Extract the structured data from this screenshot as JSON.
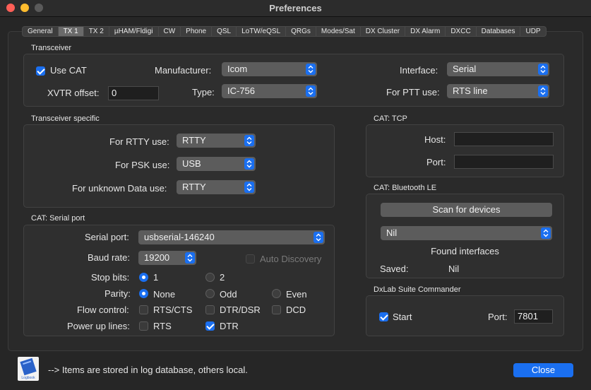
{
  "window": {
    "title": "Preferences"
  },
  "tabs": [
    "General",
    "TX 1",
    "TX 2",
    "µHAM/Fldigi",
    "CW",
    "Phone",
    "QSL",
    "LoTW/eQSL",
    "QRGs",
    "Modes/Sat",
    "DX Cluster",
    "DX Alarm",
    "DXCC",
    "Databases",
    "UDP"
  ],
  "active_tab": "TX 1",
  "transceiver": {
    "title": "Transceiver",
    "use_cat_label": "Use CAT",
    "use_cat_checked": true,
    "manufacturer_label": "Manufacturer:",
    "manufacturer_value": "Icom",
    "interface_label": "Interface:",
    "interface_value": "Serial",
    "xvtr_label": "XVTR offset:",
    "xvtr_value": "0",
    "type_label": "Type:",
    "type_value": "IC-756",
    "ptt_label": "For PTT use:",
    "ptt_value": "RTS line"
  },
  "transceiver_specific": {
    "title": "Transceiver specific",
    "rtty_label": "For RTTY use:",
    "rtty_value": "RTTY",
    "psk_label": "For PSK use:",
    "psk_value": "USB",
    "unknown_label": "For unknown Data use:",
    "unknown_value": "RTTY"
  },
  "cat_serial": {
    "title": "CAT: Serial port",
    "port_label": "Serial port:",
    "port_value": "usbserial-146240",
    "baud_label": "Baud rate:",
    "baud_value": "19200",
    "auto_discovery_label": "Auto Discovery",
    "stop_bits_label": "Stop bits:",
    "stop_bits_options": [
      "1",
      "2"
    ],
    "parity_label": "Parity:",
    "parity_options": [
      "None",
      "Odd",
      "Even"
    ],
    "flow_label": "Flow control:",
    "flow_options": [
      "RTS/CTS",
      "DTR/DSR",
      "DCD"
    ],
    "power_label": "Power up lines:",
    "power_options": [
      "RTS",
      "DTR"
    ]
  },
  "cat_tcp": {
    "title": "CAT: TCP",
    "host_label": "Host:",
    "host_value": "",
    "port_label": "Port:",
    "port_value": ""
  },
  "cat_bluetooth": {
    "title": "CAT: Bluetooth LE",
    "scan_label": "Scan for devices",
    "device_value": "Nil",
    "found_label": "Found interfaces",
    "saved_label": "Saved:",
    "saved_value": "Nil"
  },
  "dxlab": {
    "title": "DxLab Suite Commander",
    "start_label": "Start",
    "port_label": "Port:",
    "port_value": "7801"
  },
  "footer": {
    "icon_text": "Logbook",
    "note": "--> Items are stored in log database, others local.",
    "close_label": "Close"
  },
  "colors": {
    "accent": "#1a6ff0",
    "panel": "#2f2f2f",
    "background": "#262626"
  }
}
